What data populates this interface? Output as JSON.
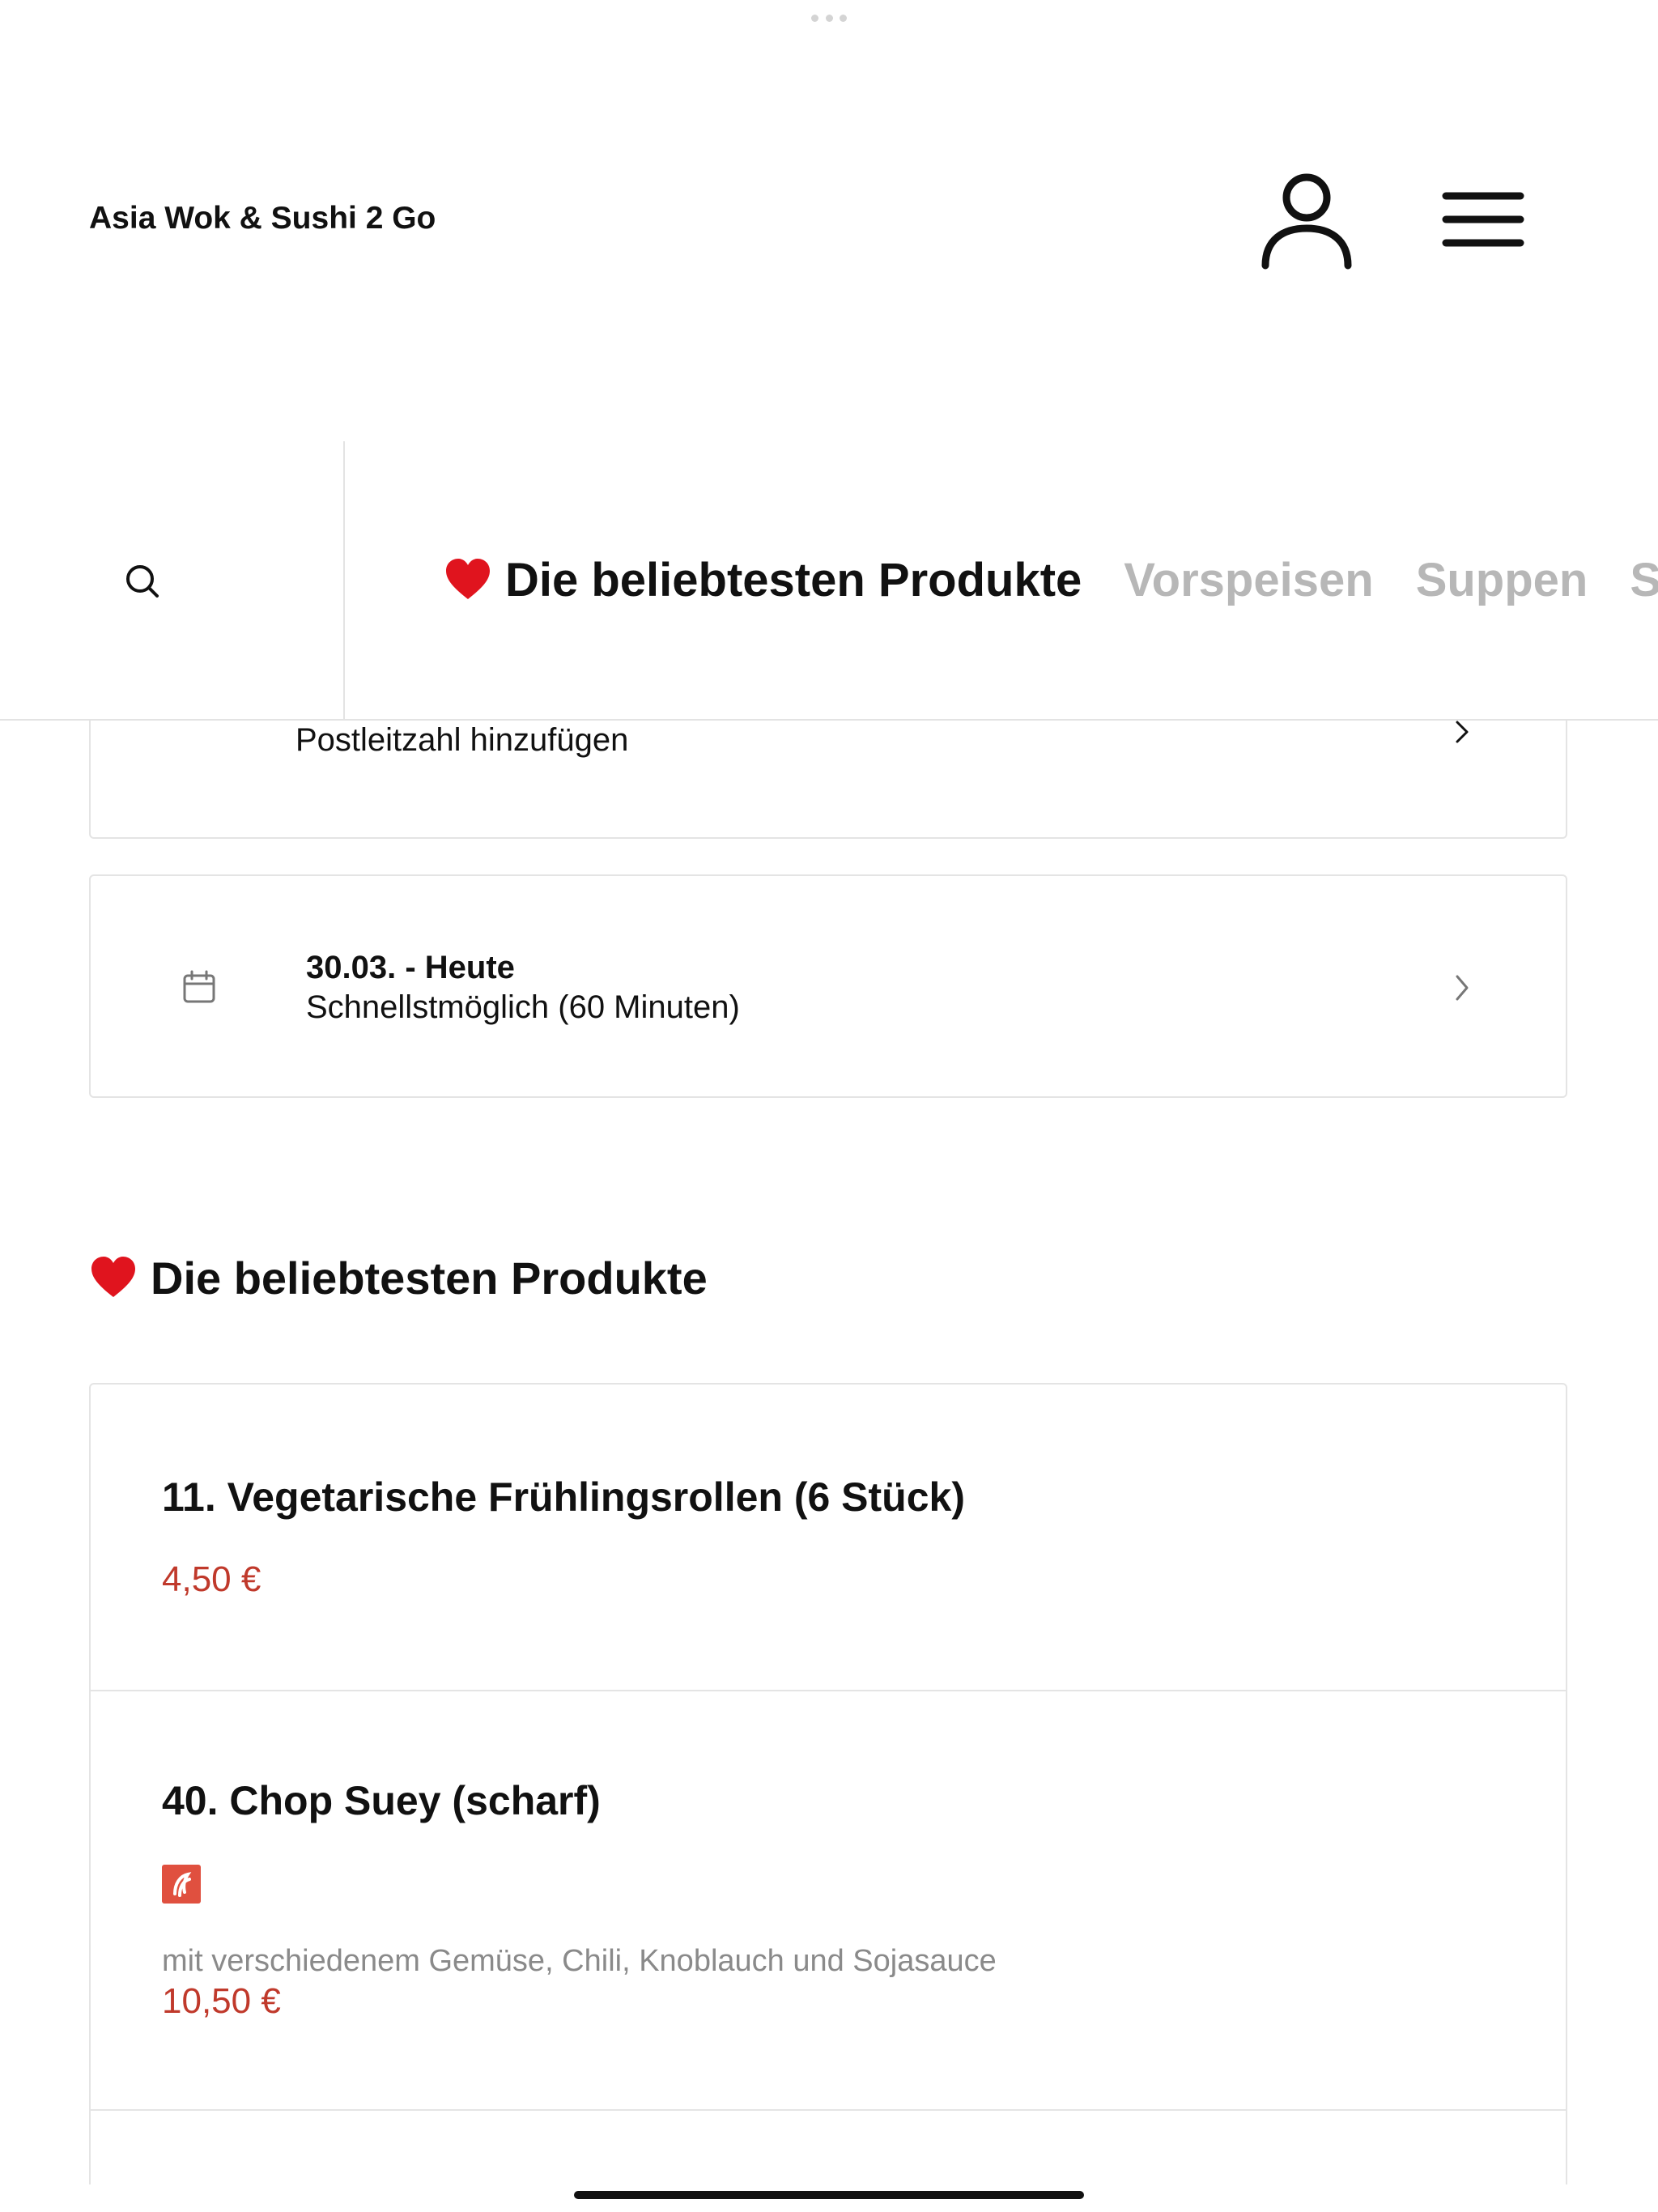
{
  "header": {
    "shop_name": "Asia Wok & Sushi 2 Go"
  },
  "category_tabs": [
    {
      "label": "Die beliebtesten Produkte",
      "active": true,
      "icon": "heart-icon"
    },
    {
      "label": "Vorspeisen",
      "active": false
    },
    {
      "label": "Suppen",
      "active": false
    },
    {
      "label": "S",
      "active": false
    }
  ],
  "delivery": {
    "postal_label": "Postleitzahl hinzufügen",
    "date": "30.03. - Heute",
    "mode": "Schnellstmöglich (60 Minuten)"
  },
  "section": {
    "title": "Die beliebtesten Produkte",
    "icon": "heart-icon"
  },
  "products": [
    {
      "name": "11. Vegetarische Frühlingsrollen (6 Stück)",
      "price": "4,50 €"
    },
    {
      "name": "40. Chop Suey (scharf)",
      "badge": "spicy-icon",
      "description": "mit verschiedenem Gemüse, Chili, Knoblauch und Sojasauce",
      "price": "10,50 €"
    }
  ],
  "colors": {
    "price": "#c0392b",
    "spicy_badge": "#e0503f",
    "tab_inactive": "#b7b7b7",
    "heart": "#e0141e"
  }
}
